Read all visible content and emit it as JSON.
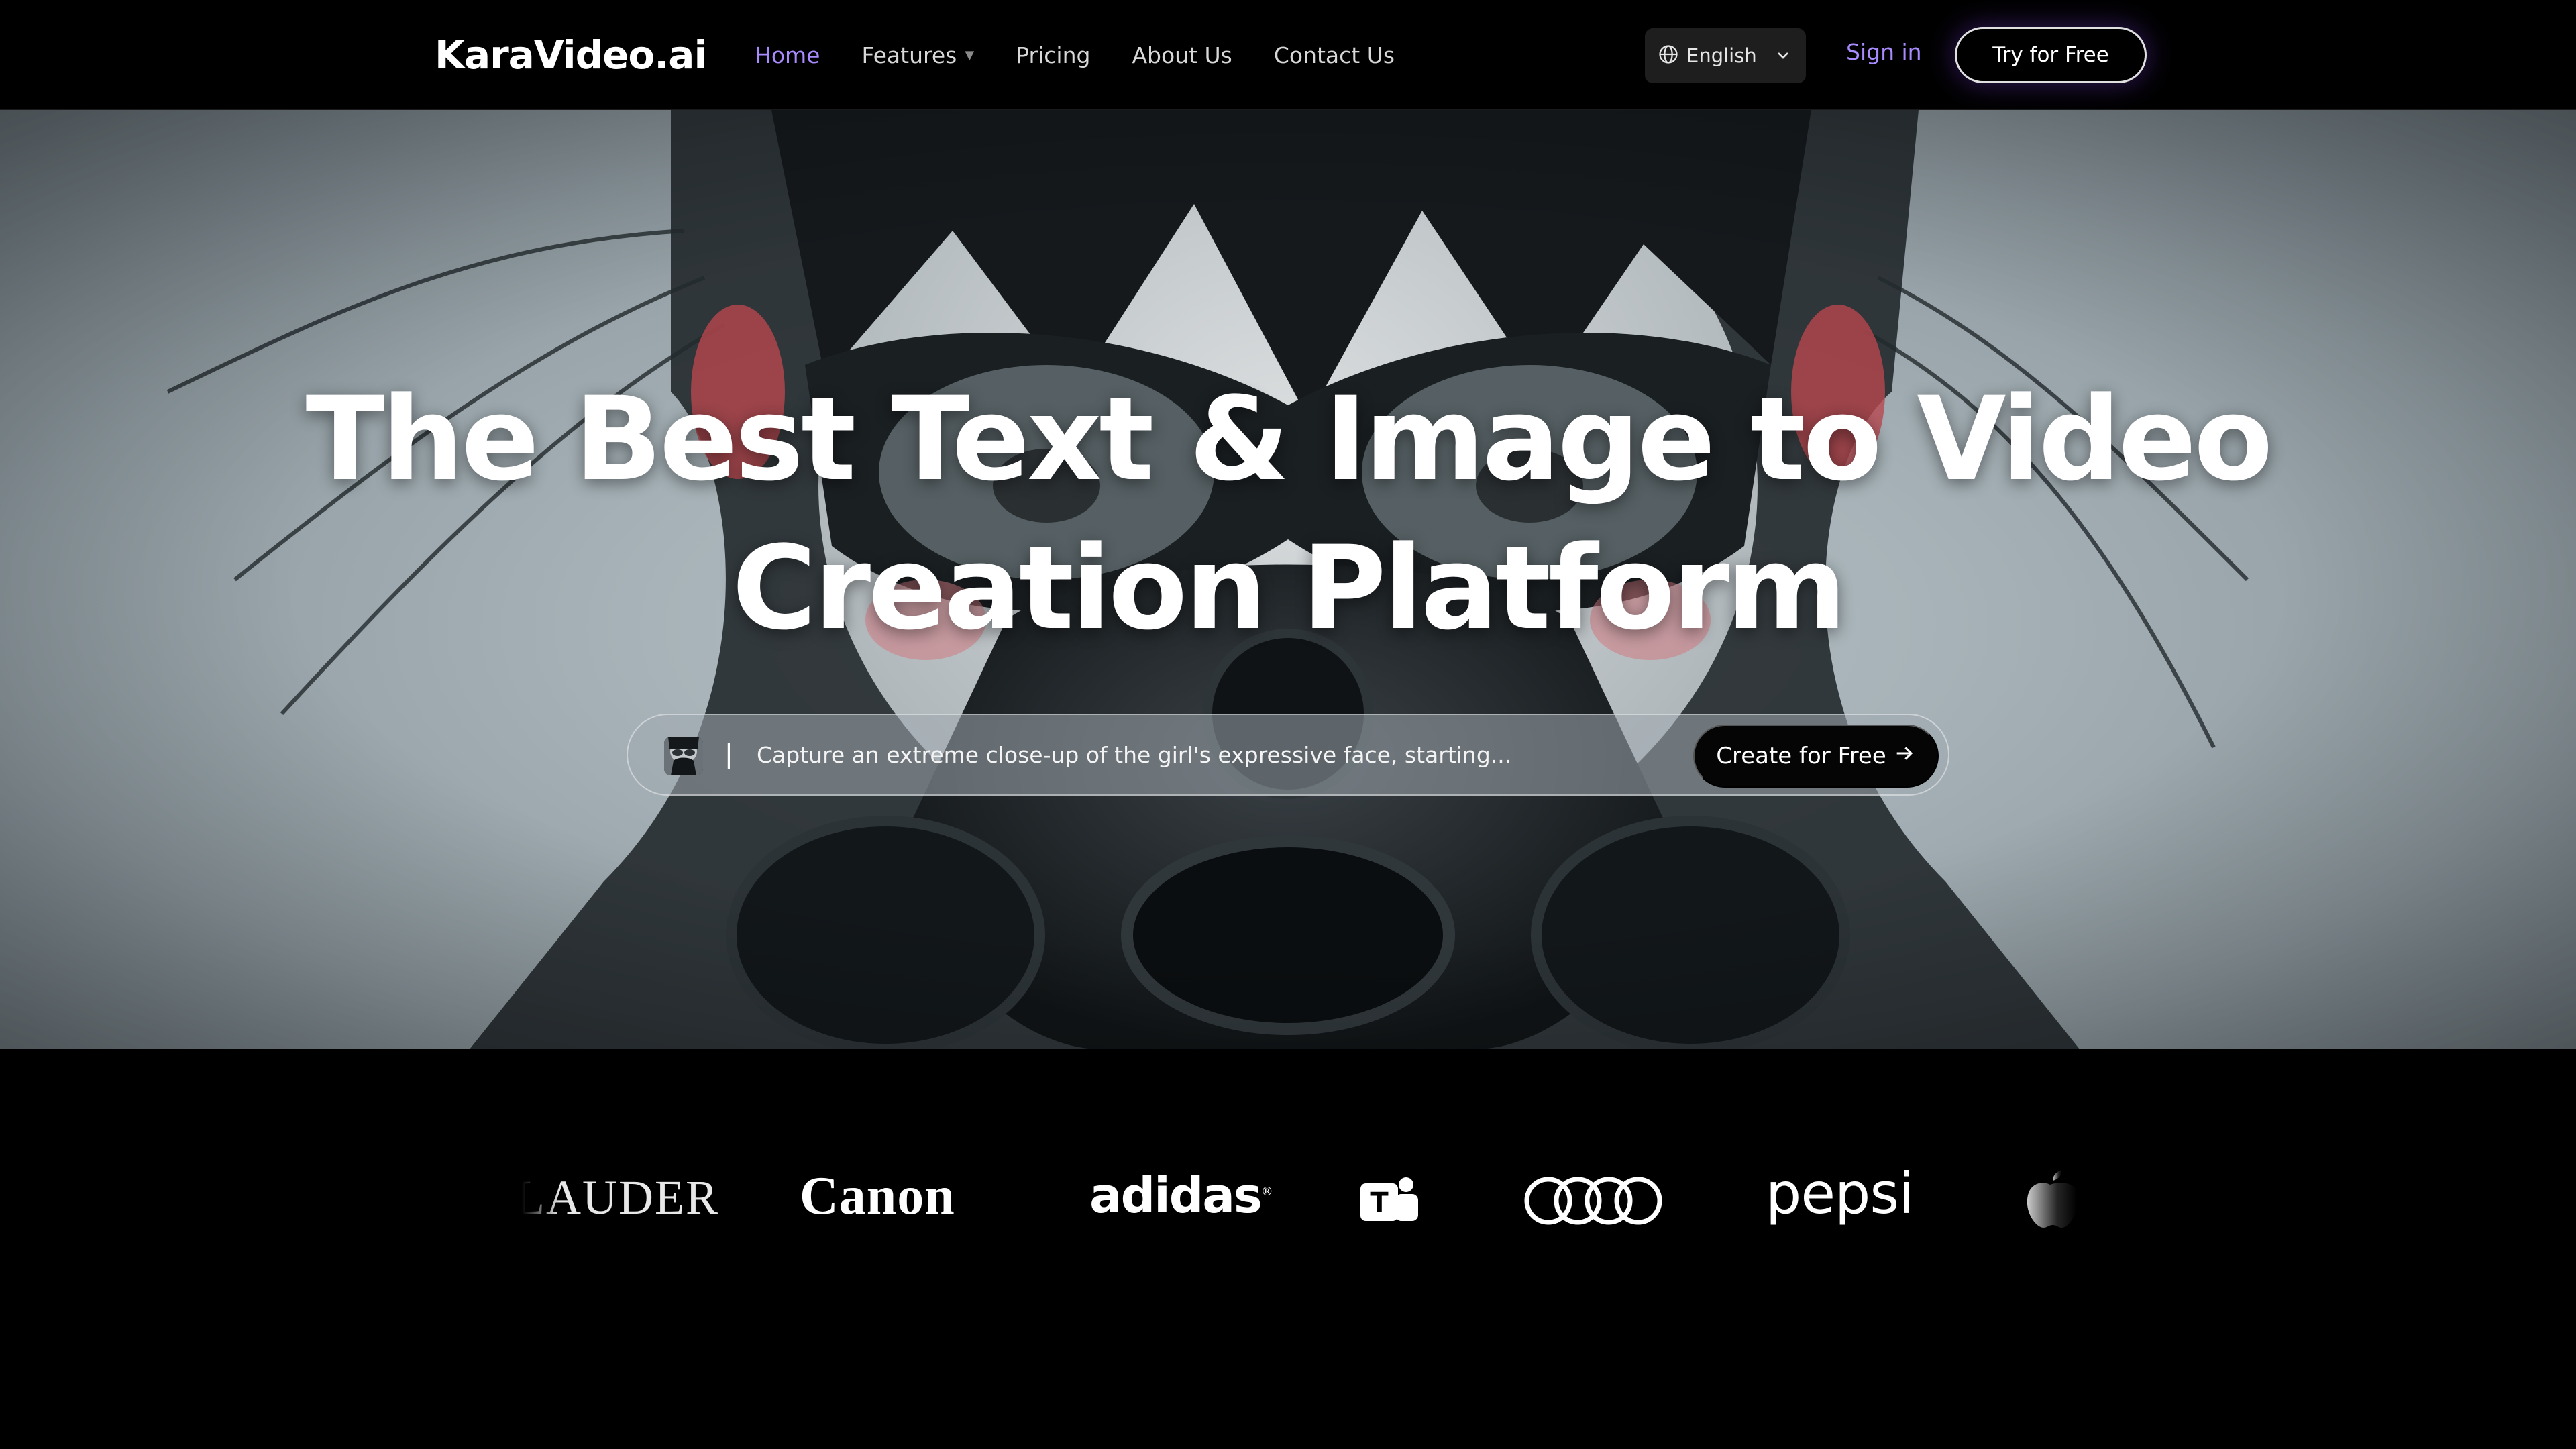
{
  "nav": {
    "logo": "KaraVideo.ai",
    "links": [
      {
        "label": "Home",
        "active": true
      },
      {
        "label": "Features",
        "has_dropdown": true
      },
      {
        "label": "Pricing"
      },
      {
        "label": "About Us"
      },
      {
        "label": "Contact Us"
      }
    ],
    "language": {
      "label": "English",
      "icon": "globe-icon"
    },
    "signin_label": "Sign in",
    "cta_label": "Try for Free"
  },
  "hero": {
    "title_line1": "The Best Text & Image to Video",
    "title_line2": "Creation Platform",
    "prompt": {
      "separator": "|",
      "text": "Capture an extreme close-up of the girl's expressive face, starting...",
      "button_label": "Create for Free",
      "button_icon": "arrow-right-icon"
    }
  },
  "brands": {
    "items": [
      "LAUDER",
      "Canon",
      "adidas",
      "Microsoft Teams",
      "Audi",
      "pepsi",
      "Apple"
    ],
    "lauder": "LAUDER",
    "canon": "Canon",
    "adidas": "adidas",
    "adidas_mark": "®",
    "pepsi": "pepsi"
  },
  "colors": {
    "accent": "#a98bff",
    "background": "#000000",
    "hero_fog": "#a7b3b8"
  }
}
